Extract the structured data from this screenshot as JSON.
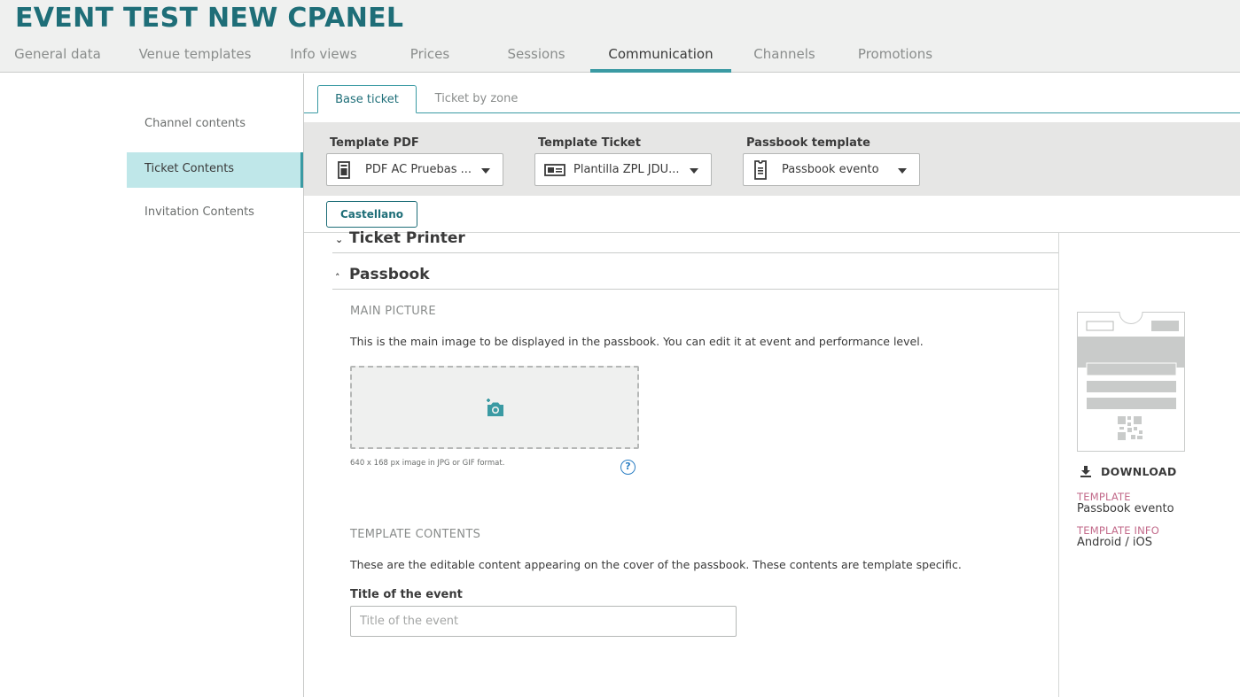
{
  "header": {
    "title": "EVENT TEST NEW CPANEL",
    "tabs": [
      {
        "label": "General data"
      },
      {
        "label": "Venue templates"
      },
      {
        "label": "Info views"
      },
      {
        "label": "Prices"
      },
      {
        "label": "Sessions"
      },
      {
        "label": "Communication",
        "active": true
      },
      {
        "label": "Channels"
      },
      {
        "label": "Promotions"
      }
    ]
  },
  "sidebar": {
    "items": [
      {
        "label": "Channel contents"
      },
      {
        "label": "Ticket Contents",
        "active": true
      },
      {
        "label": "Invitation Contents"
      }
    ]
  },
  "subtabs": [
    {
      "label": "Base ticket",
      "active": true
    },
    {
      "label": "Ticket by zone"
    }
  ],
  "templates": {
    "pdf": {
      "label": "Template PDF",
      "value": "PDF AC Pruebas ..."
    },
    "ticket": {
      "label": "Template Ticket",
      "value": "Plantilla ZPL JDU..."
    },
    "passbook": {
      "label": "Passbook template",
      "value": "Passbook evento"
    }
  },
  "language": {
    "label": "Castellano"
  },
  "sections": {
    "ticket_printer": {
      "title": "Ticket Printer"
    },
    "passbook": {
      "title": "Passbook"
    }
  },
  "main_picture": {
    "label": "MAIN PICTURE",
    "description": "This is the main image to be displayed in the passbook. You can edit it at event and performance level.",
    "hint": "640 x 168 px image in JPG or GIF format.",
    "help": "?"
  },
  "template_contents": {
    "label": "TEMPLATE CONTENTS",
    "description": "These are the editable content appearing on the cover of the passbook. These contents are template specific.",
    "field_label": "Title of the event",
    "field_placeholder": "Title of the event",
    "field_value": ""
  },
  "preview": {
    "download": "DOWNLOAD",
    "template_key": "TEMPLATE",
    "template_value": "Passbook evento",
    "info_key": "TEMPLATE INFO",
    "info_value": "Android / iOS"
  },
  "colors": {
    "brand": "#1e6e78",
    "accent": "#3a9aa3",
    "meta_key": "#c26a8a"
  }
}
